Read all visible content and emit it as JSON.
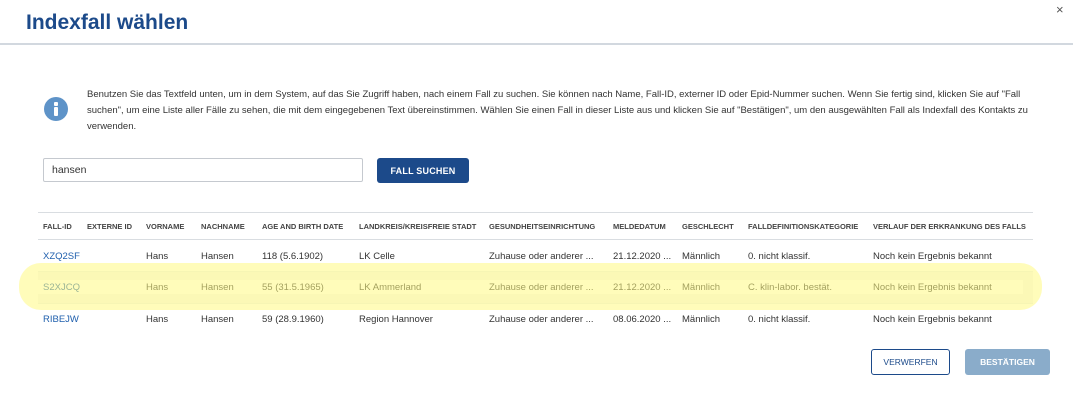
{
  "dialog": {
    "title": "Indexfall wählen",
    "close_glyph": "×"
  },
  "info": {
    "icon": "info-icon",
    "text": "Benutzen Sie das Textfeld unten, um in dem System, auf das Sie Zugriff haben, nach einem Fall zu suchen. Sie können nach Name, Fall-ID, externer ID oder Epid-Nummer suchen. Wenn Sie fertig sind, klicken Sie auf \"Fall suchen\", um eine Liste aller Fälle zu sehen, die mit dem eingegebenen Text übereinstimmen. Wählen Sie einen Fall in dieser Liste aus und klicken Sie auf \"Bestätigen\", um den ausgewählten Fall als Indexfall des Kontakts zu verwenden."
  },
  "search": {
    "value": "hansen",
    "button_label": "FALL SUCHEN"
  },
  "table": {
    "headers": [
      "FALL-ID",
      "EXTERNE ID",
      "VORNAME",
      "NACHNAME",
      "AGE AND BIRTH DATE",
      "LANDKREIS/KREISFREIE STADT",
      "GESUNDHEITSEINRICHTUNG",
      "MELDEDATUM",
      "GESCHLECHT",
      "FALLDEFINITIONSKATEGORIE",
      "VERLAUF DER ERKRANKUNG DES FALLS"
    ],
    "rows": [
      [
        "XZQ2SF",
        "",
        "Hans",
        "Hansen",
        "118 (5.6.1902)",
        "LK Celle",
        "Zuhause oder anderer ...",
        "21.12.2020 ...",
        "Männlich",
        "0. nicht klassif.",
        "Noch kein Ergebnis bekannt"
      ],
      [
        "S2XJCQ",
        "",
        "Hans",
        "Hansen",
        "55 (31.5.1965)",
        "LK Ammerland",
        "Zuhause oder anderer ...",
        "21.12.2020 ...",
        "Männlich",
        "C. klin-labor. bestät.",
        "Noch kein Ergebnis bekannt"
      ],
      [
        "RIBEJW",
        "",
        "Hans",
        "Hansen",
        "59 (28.9.1960)",
        "Region Hannover",
        "Zuhause oder anderer ...",
        "08.06.2020 ...",
        "Männlich",
        "0. nicht klassif.",
        "Noch kein Ergebnis bekannt"
      ]
    ]
  },
  "footer": {
    "discard_label": "VERWERFEN",
    "confirm_label": "BESTÄTIGEN"
  },
  "colors": {
    "brand": "#1c4a8a",
    "link": "#1f5fad",
    "info_icon": "#5e93c8",
    "confirm_disabled": "#8aacca",
    "highlight": "#fffa82"
  }
}
